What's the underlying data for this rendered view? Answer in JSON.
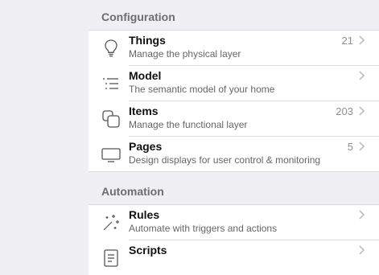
{
  "sections": [
    {
      "title": "Configuration",
      "items": [
        {
          "icon": "lightbulb-icon",
          "title": "Things",
          "subtitle": "Manage the physical layer",
          "count": "21"
        },
        {
          "icon": "list-icon",
          "title": "Model",
          "subtitle": "The semantic model of your home",
          "count": ""
        },
        {
          "icon": "squares-icon",
          "title": "Items",
          "subtitle": "Manage the functional layer",
          "count": "203"
        },
        {
          "icon": "display-icon",
          "title": "Pages",
          "subtitle": "Design displays for user control & monitoring",
          "count": "5"
        }
      ]
    },
    {
      "title": "Automation",
      "items": [
        {
          "icon": "sparkles-icon",
          "title": "Rules",
          "subtitle": "Automate with triggers and actions",
          "count": ""
        },
        {
          "icon": "script-icon",
          "title": "Scripts",
          "subtitle": "",
          "count": ""
        }
      ]
    }
  ]
}
